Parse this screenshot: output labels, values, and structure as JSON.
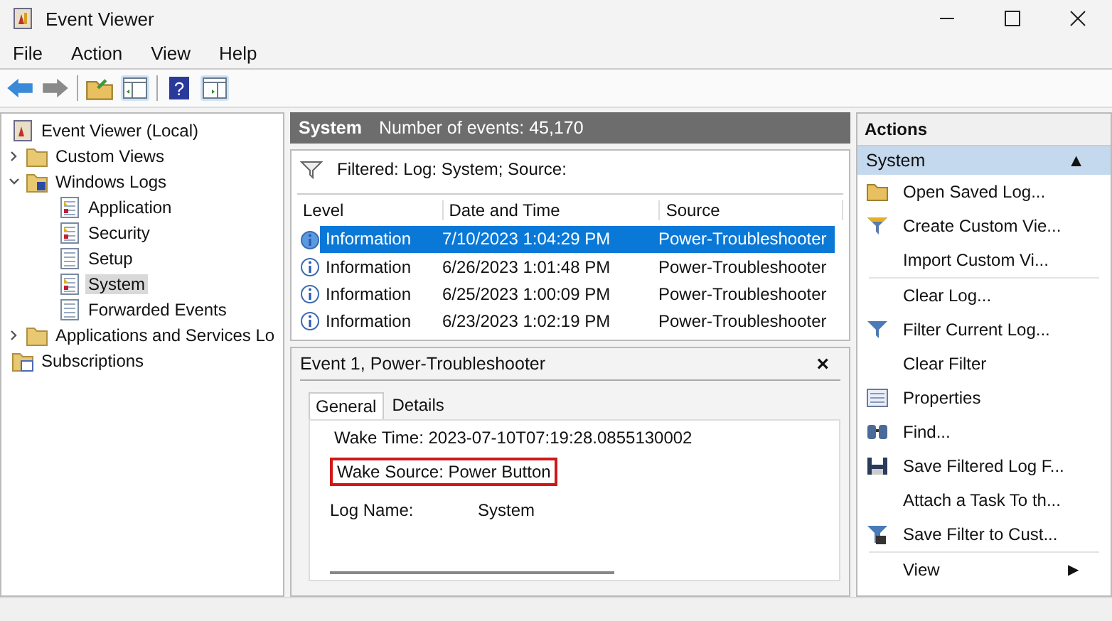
{
  "window": {
    "title": "Event Viewer"
  },
  "menu": [
    "File",
    "Action",
    "View",
    "Help"
  ],
  "toolbar": {
    "help_glyph": "?"
  },
  "tree": [
    {
      "label": "Event Viewer (Local)",
      "kind": "root",
      "selected": false,
      "children": [
        {
          "label": "Custom Views",
          "kind": "folder",
          "expanded": false,
          "selected": false
        },
        {
          "label": "Windows Logs",
          "kind": "folder",
          "expanded": true,
          "selected": false,
          "children": [
            {
              "label": "Application",
              "kind": "log",
              "selected": false
            },
            {
              "label": "Security",
              "kind": "log",
              "selected": false
            },
            {
              "label": "Setup",
              "kind": "plainlog",
              "selected": false
            },
            {
              "label": "System",
              "kind": "log",
              "selected": true
            },
            {
              "label": "Forwarded Events",
              "kind": "plainlog",
              "selected": false
            }
          ]
        },
        {
          "label": "Applications and Services Lo",
          "kind": "folder",
          "expanded": false,
          "selected": false
        },
        {
          "label": "Subscriptions",
          "kind": "subs",
          "selected": false
        }
      ]
    }
  ],
  "log_header": {
    "name": "System",
    "count": "Number of events: 45,170"
  },
  "filter_text": "Filtered: Log: System; Source:",
  "table": {
    "columns": [
      "Level",
      "Date and Time",
      "Source"
    ],
    "rows": [
      {
        "level": "Information",
        "date": "7/10/2023 1:04:29 PM",
        "source": "Power-Troubleshooter",
        "selected": true
      },
      {
        "level": "Information",
        "date": "6/26/2023 1:01:48 PM",
        "source": "Power-Troubleshooter",
        "selected": false
      },
      {
        "level": "Information",
        "date": "6/25/2023 1:00:09 PM",
        "source": "Power-Troubleshooter",
        "selected": false
      },
      {
        "level": "Information",
        "date": "6/23/2023 1:02:19 PM",
        "source": "Power-Troubleshooter",
        "selected": false
      }
    ]
  },
  "details": {
    "title": "Event 1, Power-Troubleshooter",
    "close": "×",
    "tabs": [
      {
        "label": "General",
        "selected": true
      },
      {
        "label": "Details",
        "selected": false
      }
    ],
    "lines": [
      {
        "text": "Wake Time: 2023-07-10T07:19:28.0855130002",
        "highlighted": false
      },
      {
        "text": "Wake Source: Power Button",
        "highlighted": true
      }
    ],
    "fields": [
      {
        "label": "Log Name:",
        "value": "System"
      }
    ]
  },
  "actions": {
    "title": "Actions",
    "section": "System",
    "section_arrow": "▲",
    "groups": [
      [
        {
          "label": "Open Saved Log...",
          "kind": "folder"
        },
        {
          "label": "Create Custom Vie...",
          "kind": "filter-new"
        },
        {
          "label": "Import Custom Vi...",
          "kind": "plain"
        }
      ],
      [
        {
          "label": "Clear Log...",
          "kind": "plain"
        },
        {
          "label": "Filter Current Log...",
          "kind": "filter"
        },
        {
          "label": "Clear Filter",
          "kind": "plain"
        },
        {
          "label": "Properties",
          "kind": "properties"
        },
        {
          "label": "Find...",
          "kind": "find"
        },
        {
          "label": "Save Filtered Log F...",
          "kind": "save"
        },
        {
          "label": "Attach a Task To th...",
          "kind": "plain"
        },
        {
          "label": "Save Filter to Cust...",
          "kind": "filter-save"
        }
      ],
      [
        {
          "label": "View",
          "kind": "submenu",
          "arrow": "▶"
        }
      ]
    ]
  }
}
